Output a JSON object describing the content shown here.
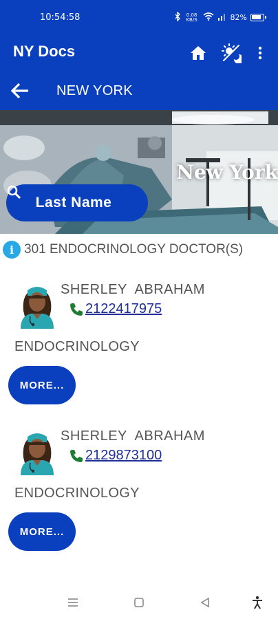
{
  "status_bar": {
    "time": "10:54:58",
    "net_speed": "0.08 KB/S",
    "battery": "82%"
  },
  "app_bar": {
    "title": "NY Docs",
    "icons": [
      "home-icon",
      "theme-toggle-icon",
      "overflow-menu-icon"
    ]
  },
  "sub_bar": {
    "title": "NEW YORK"
  },
  "hero": {
    "city_label": "New York",
    "search_label": "Last Name"
  },
  "results": {
    "count_text": "301 ENDOCRINOLOGY DOCTOR(S)"
  },
  "doctors": [
    {
      "name": "SHERLEY  ABRAHAM",
      "phone": "2122417975",
      "specialty": "ENDOCRINOLOGY",
      "more_label": "MORE..."
    },
    {
      "name": "SHERLEY  ABRAHAM",
      "phone": "2129873100",
      "specialty": "ENDOCRINOLOGY",
      "more_label": "MORE..."
    }
  ],
  "colors": {
    "primary": "#0a3fbe",
    "info": "#29a8e6",
    "phone_icon": "#1e7d32",
    "link": "#1f2f9a"
  }
}
